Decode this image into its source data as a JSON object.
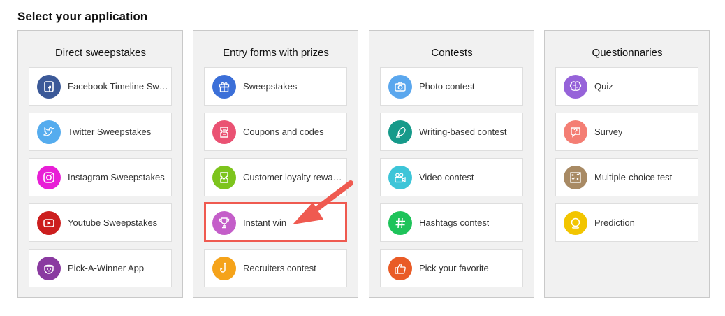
{
  "page": {
    "title": "Select your application"
  },
  "columns": [
    {
      "title": "Direct sweepstakes",
      "items": [
        {
          "label": "Facebook Timeline Sw…",
          "icon": "facebook-icon",
          "color": "#3b5998"
        },
        {
          "label": "Twitter Sweepstakes",
          "icon": "twitter-bird-icon",
          "color": "#55acee"
        },
        {
          "label": "Instagram Sweepstakes",
          "icon": "instagram-icon",
          "color": "#e81fd6"
        },
        {
          "label": "Youtube Sweepstakes",
          "icon": "youtube-play-icon",
          "color": "#cc1e1e"
        },
        {
          "label": "Pick-A-Winner App",
          "icon": "lottery-drum-icon",
          "color": "#8a3aa0"
        }
      ]
    },
    {
      "title": "Entry forms with prizes",
      "items": [
        {
          "label": "Sweepstakes",
          "icon": "gift-icon",
          "color": "#3b6fd8"
        },
        {
          "label": "Coupons and codes",
          "icon": "coupon-ticket-icon",
          "color": "#ea5273"
        },
        {
          "label": "Customer loyalty rewa…",
          "icon": "loyalty-ticket-icon",
          "color": "#7dc41d"
        },
        {
          "label": "Instant win",
          "icon": "trophy-icon",
          "color": "#c45ec9"
        },
        {
          "label": "Recruiters contest",
          "icon": "hook-icon",
          "color": "#f5a31a"
        }
      ]
    },
    {
      "title": "Contests",
      "items": [
        {
          "label": "Photo contest",
          "icon": "camera-icon",
          "color": "#5aa7ee"
        },
        {
          "label": "Writing-based contest",
          "icon": "quill-icon",
          "color": "#169a8a"
        },
        {
          "label": "Video contest",
          "icon": "video-camera-icon",
          "color": "#3dc5d8"
        },
        {
          "label": "Hashtags contest",
          "icon": "hashtag-icon",
          "color": "#1ec35a"
        },
        {
          "label": "Pick your favorite",
          "icon": "thumbs-up-icon",
          "color": "#e95b26"
        }
      ]
    },
    {
      "title": "Questionnaries",
      "items": [
        {
          "label": "Quiz",
          "icon": "brain-icon",
          "color": "#9663d9"
        },
        {
          "label": "Survey",
          "icon": "question-bubble-icon",
          "color": "#f47e74"
        },
        {
          "label": "Multiple-choice test",
          "icon": "checklist-icon",
          "color": "#a88a64"
        },
        {
          "label": "Prediction",
          "icon": "crystal-ball-icon",
          "color": "#f2c500"
        }
      ]
    }
  ],
  "highlight": {
    "color": "#ef5a50"
  }
}
